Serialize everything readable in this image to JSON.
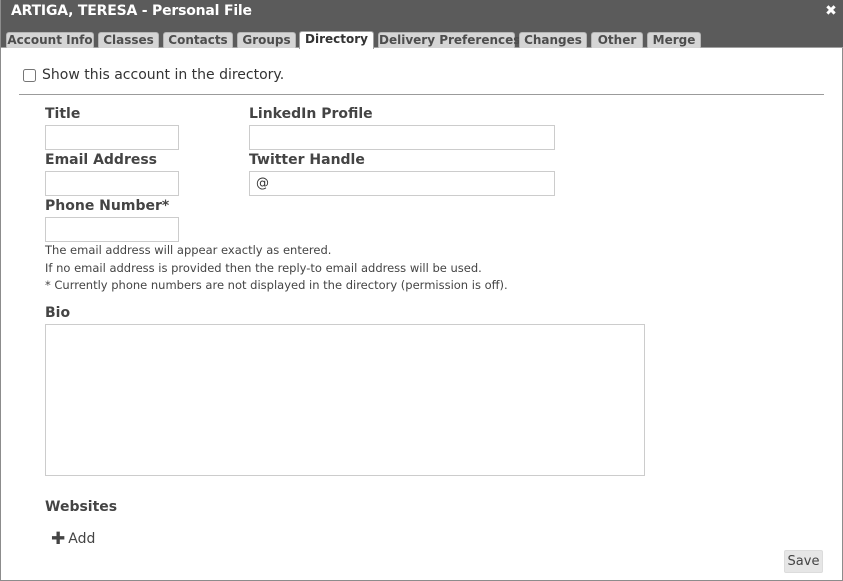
{
  "window": {
    "title": "ARTIGA, TERESA - Personal File",
    "close_glyph": "✖"
  },
  "tabs": [
    {
      "label": "Account Info",
      "active": false
    },
    {
      "label": "Classes",
      "active": false
    },
    {
      "label": "Contacts",
      "active": false
    },
    {
      "label": "Groups",
      "active": false
    },
    {
      "label": "Directory",
      "active": true
    },
    {
      "label": "Delivery Preferences",
      "active": false
    },
    {
      "label": "Changes",
      "active": false
    },
    {
      "label": "Other",
      "active": false
    },
    {
      "label": "Merge",
      "active": false
    }
  ],
  "directory": {
    "show_in_directory_label": "Show this account in the directory.",
    "show_in_directory_checked": false
  },
  "form": {
    "title_label": "Title",
    "title_value": "",
    "linkedin_label": "LinkedIn Profile",
    "linkedin_value": "",
    "email_label": "Email Address",
    "email_value": "",
    "twitter_label": "Twitter Handle",
    "twitter_value": "@",
    "phone_label": "Phone Number*",
    "phone_value": ""
  },
  "notes": {
    "line1": "The email address will appear exactly as entered.",
    "line2": "If no email address is provided then the reply-to email address will be used.",
    "line3": "* Currently phone numbers are not displayed in the directory (permission is off)."
  },
  "bio": {
    "label": "Bio",
    "value": ""
  },
  "websites": {
    "label": "Websites",
    "add_icon": "✚",
    "add_label": "Add"
  },
  "footer": {
    "save_label": "Save"
  }
}
